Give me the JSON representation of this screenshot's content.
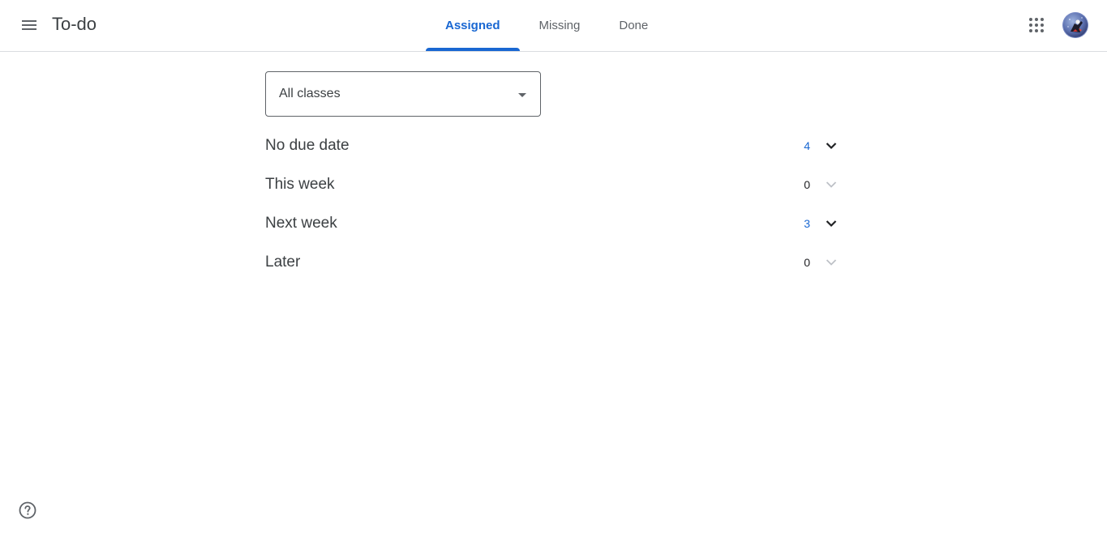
{
  "header": {
    "title": "To-do",
    "menu_icon": "hamburger-menu-icon",
    "apps_icon": "apps-grid-icon"
  },
  "tabs": [
    {
      "label": "Assigned",
      "active": true
    },
    {
      "label": "Missing",
      "active": false
    },
    {
      "label": "Done",
      "active": false
    }
  ],
  "filter": {
    "selected": "All classes",
    "icon": "dropdown-arrow-icon"
  },
  "sections": [
    {
      "label": "No due date",
      "count": "4",
      "has_items": true
    },
    {
      "label": "This week",
      "count": "0",
      "has_items": false
    },
    {
      "label": "Next week",
      "count": "3",
      "has_items": true
    },
    {
      "label": "Later",
      "count": "0",
      "has_items": false
    }
  ],
  "footer": {
    "help_icon": "help-icon"
  },
  "colors": {
    "accent": "#1967d2",
    "text": "#3c4043",
    "muted": "#5f6368",
    "divider": "#dadce0"
  }
}
